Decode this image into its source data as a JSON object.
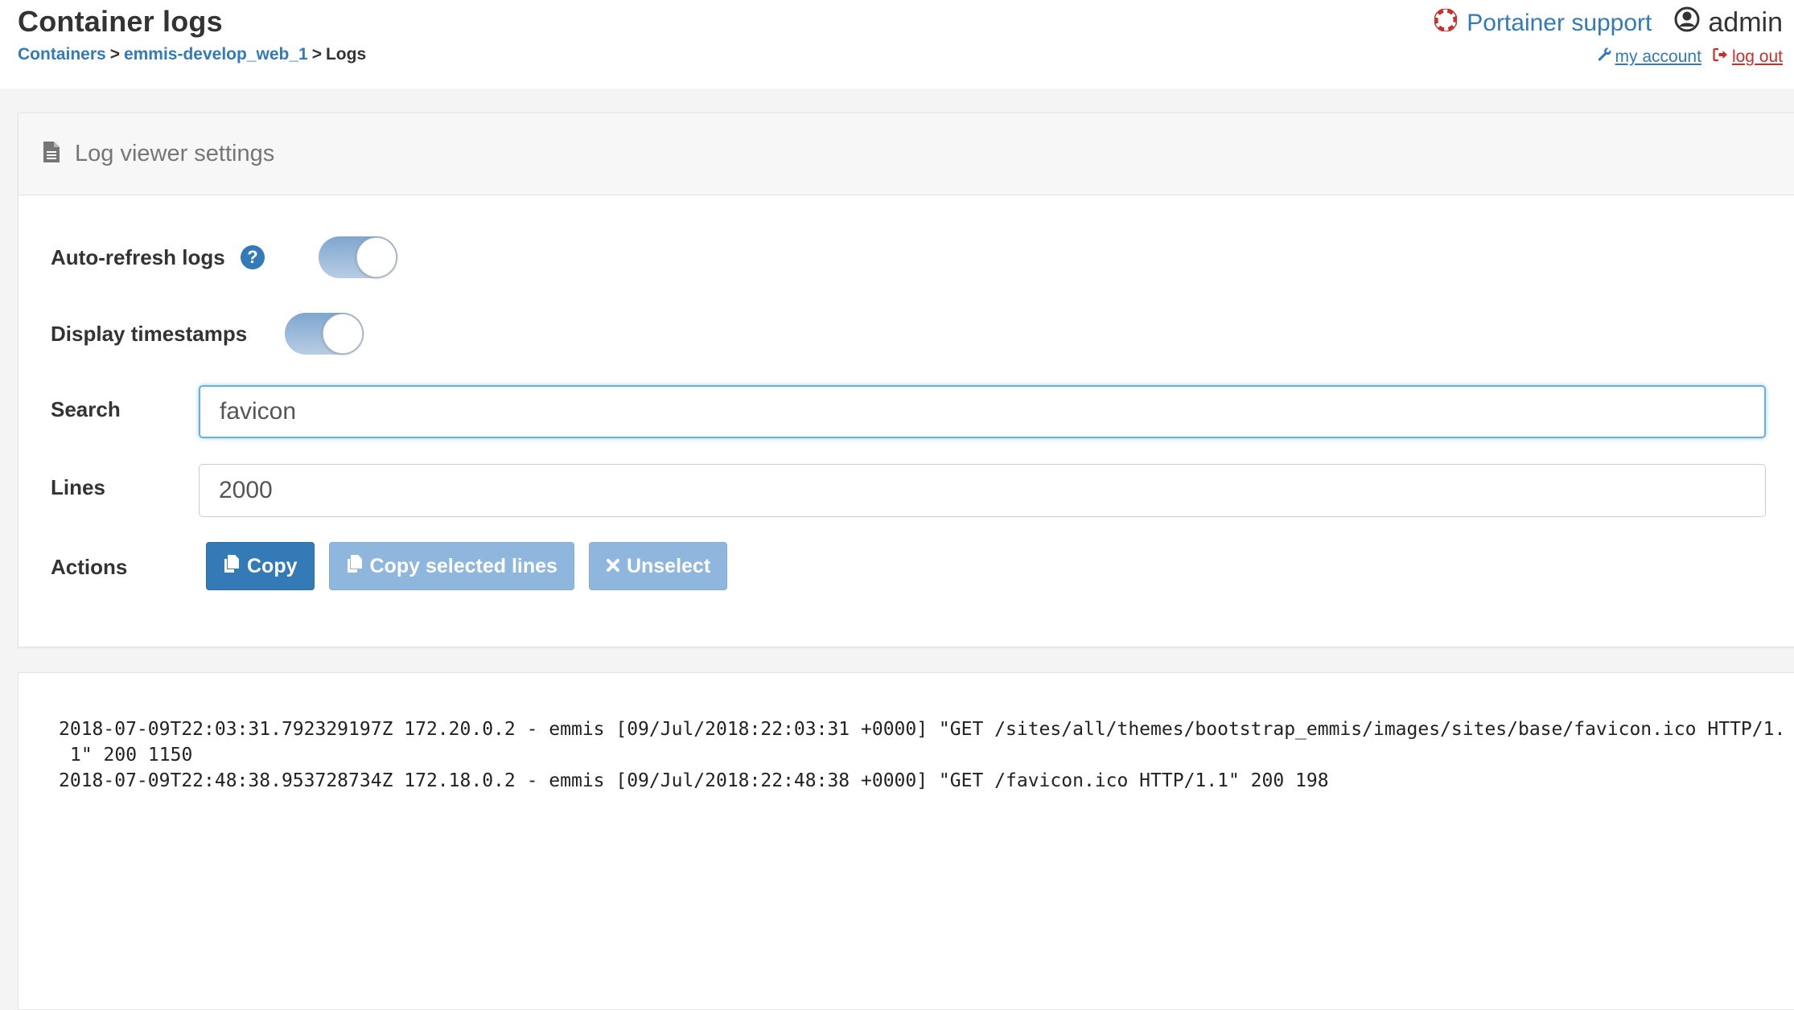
{
  "header": {
    "title": "Container logs",
    "breadcrumb": {
      "containers": "Containers",
      "sep1": ">",
      "container": "emmis-develop_web_1",
      "sep2": ">",
      "current": "Logs"
    },
    "support_label": "Portainer support",
    "username": "admin",
    "my_account_label": "my account",
    "logout_label": "log out",
    "icons": {
      "support": "life-ring-icon",
      "user": "user-circle-icon",
      "account": "wrench-icon",
      "logout": "sign-out-icon"
    }
  },
  "settings": {
    "title": "Log viewer settings",
    "title_icon": "file-text-icon",
    "auto_refresh": {
      "label": "Auto-refresh logs",
      "enabled": true,
      "help_icon": "question-circle-icon"
    },
    "timestamps": {
      "label": "Display timestamps",
      "enabled": true
    },
    "search": {
      "label": "Search",
      "value": "favicon"
    },
    "lines": {
      "label": "Lines",
      "value": "2000"
    },
    "actions": {
      "label": "Actions",
      "copy_label": "Copy",
      "copy_selected_label": "Copy selected lines",
      "unselect_label": "Unselect"
    }
  },
  "logs": {
    "lines": [
      "2018-07-09T22:03:31.792329197Z 172.20.0.2 - emmis [09/Jul/2018:22:03:31 +0000] \"GET /sites/all/themes/bootstrap_emmis/images/sites/base/favicon.ico HTTP/1.1\" 200 1150",
      "2018-07-09T22:48:38.953728734Z 172.18.0.2 - emmis [09/Jul/2018:22:48:38 +0000] \"GET /favicon.ico HTTP/1.1\" 200 198"
    ]
  },
  "colors": {
    "link": "#337ab7",
    "danger": "#c9302c",
    "primary_button": "#337ab7",
    "disabled_button": "#8fb6dc",
    "toggle_on": "#7fa6cf"
  }
}
